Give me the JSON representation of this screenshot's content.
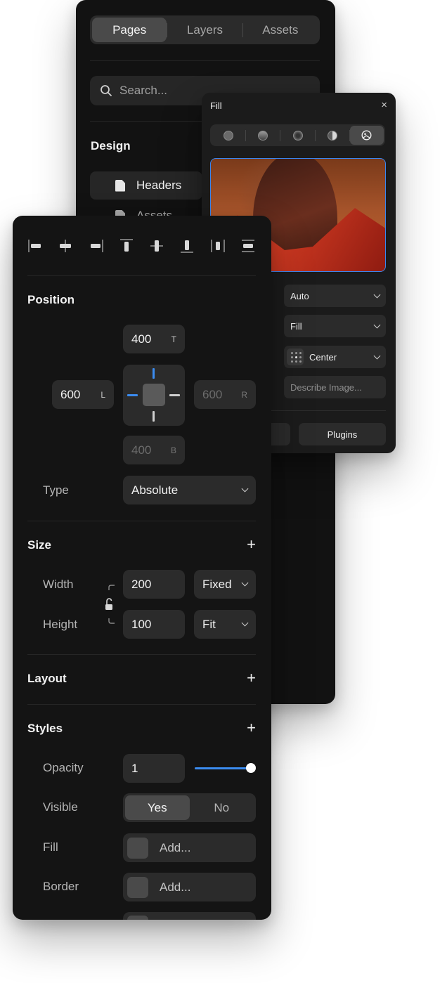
{
  "pages_panel": {
    "tabs": [
      "Pages",
      "Layers",
      "Assets"
    ],
    "active_tab": 0,
    "search_placeholder": "Search...",
    "section_title": "Design",
    "items": [
      "Headers",
      "Assets"
    ]
  },
  "fill_popover": {
    "title": "Fill",
    "close_glyph": "×",
    "modes": [
      "solid-icon",
      "linear-icon",
      "radial-icon",
      "conic-icon",
      "image-icon"
    ],
    "active_mode": 4,
    "resolution": "Auto",
    "fit": "Fill",
    "position": "Center",
    "describe_placeholder": "Describe Image...",
    "buttons": [
      "Plugins"
    ]
  },
  "properties": {
    "position": {
      "title": "Position",
      "top": {
        "value": "400",
        "suffix": "T"
      },
      "left": {
        "value": "600",
        "suffix": "L"
      },
      "right": {
        "value": "600",
        "suffix": "R"
      },
      "bottom": {
        "value": "400",
        "suffix": "B"
      },
      "type_label": "Type",
      "type_value": "Absolute"
    },
    "size": {
      "title": "Size",
      "width_label": "Width",
      "width_value": "200",
      "width_mode": "Fixed",
      "height_label": "Height",
      "height_value": "100",
      "height_mode": "Fit"
    },
    "layout": {
      "title": "Layout"
    },
    "styles": {
      "title": "Styles",
      "opacity_label": "Opacity",
      "opacity_value": "1",
      "opacity_slider": 1.0,
      "visible_label": "Visible",
      "visible_options": [
        "Yes",
        "No"
      ],
      "visible_active": 0,
      "fill_label": "Fill",
      "fill_value": "Add...",
      "border_label": "Border",
      "border_value": "Add..."
    },
    "plus_glyph": "+"
  },
  "colors": {
    "panel_bg": "#141414",
    "field_bg": "#2b2b2b",
    "accent": "#3b8cf0"
  }
}
